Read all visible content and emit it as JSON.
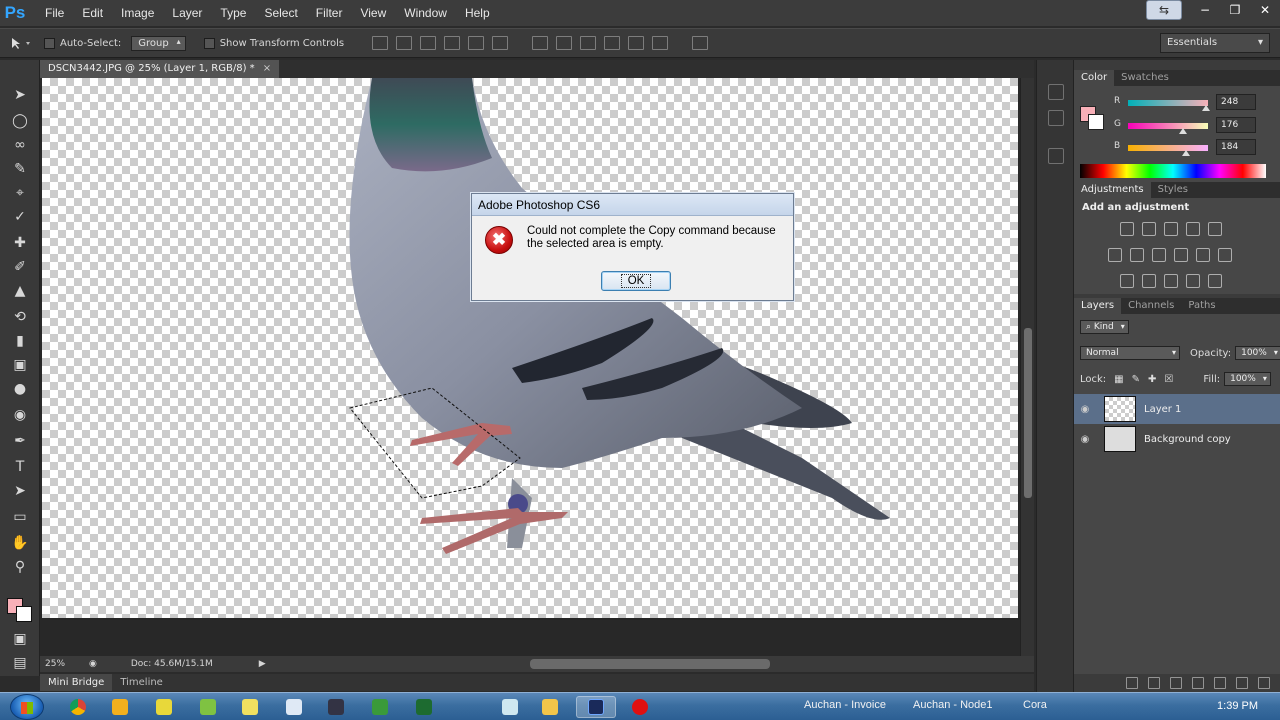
{
  "app": {
    "logo": "Ps",
    "menu": [
      "File",
      "Edit",
      "Image",
      "Layer",
      "Type",
      "Select",
      "Filter",
      "View",
      "Window",
      "Help"
    ],
    "window_buttons": [
      "⇆",
      "−",
      "❐",
      "✕"
    ]
  },
  "options_bar": {
    "auto_select_label": "Auto-Select:",
    "auto_select_value": "Group",
    "show_transform_label": "Show Transform Controls",
    "workspace": "Essentials"
  },
  "document": {
    "tab_title": "DSCN3442.JPG @ 25% (Layer 1, RGB/8) *",
    "tab_close": "×"
  },
  "status": {
    "zoom": "25%",
    "doc_size": "Doc: 45.6M/15.1M"
  },
  "bottom_tabs": [
    "Mini Bridge",
    "Timeline"
  ],
  "color_panel": {
    "tabs": [
      "Color",
      "Swatches"
    ],
    "channels": [
      {
        "label": "R",
        "value": "248",
        "level": 0.973
      },
      {
        "label": "G",
        "value": "176",
        "level": 0.69
      },
      {
        "label": "B",
        "value": "184",
        "level": 0.722
      }
    ],
    "foreground": "#f8b0b8",
    "background": "#ffffff"
  },
  "adjustments_panel": {
    "tabs": [
      "Adjustments",
      "Styles"
    ],
    "title": "Add an adjustment"
  },
  "layers_panel": {
    "tabs": [
      "Layers",
      "Channels",
      "Paths"
    ],
    "kind": "⌕ Kind",
    "blend_mode": "Normal",
    "opacity_label": "Opacity:",
    "opacity": "100%",
    "lock_label": "Lock:",
    "fill_label": "Fill:",
    "fill": "100%",
    "layers": [
      {
        "name": "Layer 1",
        "selected": true
      },
      {
        "name": "Background copy",
        "selected": false
      }
    ]
  },
  "dialog": {
    "title": "Adobe Photoshop CS6",
    "message": "Could not complete the Copy command because the selected area is empty.",
    "ok": "OK",
    "icon": "✖"
  },
  "taskbar": {
    "items": [
      "Auchan - Invoice",
      "Auchan - Node1",
      "Cora"
    ],
    "time": "1:39 PM"
  }
}
